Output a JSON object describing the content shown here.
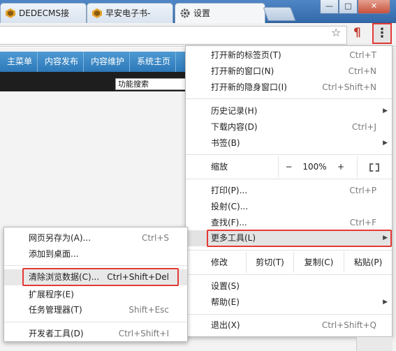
{
  "tabs": [
    {
      "label": "DEDECMS接",
      "icon": "dede-icon"
    },
    {
      "label": "早安电子书-",
      "icon": "dede-icon"
    },
    {
      "label": "设置",
      "icon": "gear-icon"
    }
  ],
  "window_controls": {
    "minimize": "—",
    "maximize": "□",
    "close": "✕"
  },
  "toolbar": {
    "star_icon": "☆",
    "extension_icon": "¶",
    "menu_icon": "⋮"
  },
  "site_nav": [
    "主菜单",
    "内容发布",
    "内容维护",
    "系统主页"
  ],
  "site_search": "功能搜索",
  "main_menu": {
    "group1": [
      {
        "label": "打开新的标签页(T)",
        "shortcut": "Ctrl+T"
      },
      {
        "label": "打开新的窗口(N)",
        "shortcut": "Ctrl+N"
      },
      {
        "label": "打开新的隐身窗口(I)",
        "shortcut": "Ctrl+Shift+N"
      }
    ],
    "group2": [
      {
        "label": "历史记录(H)",
        "shortcut": ""
      },
      {
        "label": "下载内容(D)",
        "shortcut": "Ctrl+J"
      },
      {
        "label": "书签(B)",
        "shortcut": ""
      }
    ],
    "zoom": {
      "label": "缩放",
      "minus": "−",
      "value": "100%",
      "plus": "+"
    },
    "group3": [
      {
        "label": "打印(P)...",
        "shortcut": "Ctrl+P"
      },
      {
        "label": "投射(C)...",
        "shortcut": ""
      },
      {
        "label": "查找(F)...",
        "shortcut": "Ctrl+F"
      },
      {
        "label": "更多工具(L)",
        "shortcut": ""
      }
    ],
    "edit": {
      "label": "修改",
      "cut": "剪切(T)",
      "copy": "复制(C)",
      "paste": "粘贴(P)"
    },
    "group4": [
      {
        "label": "设置(S)",
        "shortcut": ""
      },
      {
        "label": "帮助(E)",
        "shortcut": ""
      }
    ],
    "exit": {
      "label": "退出(X)",
      "shortcut": "Ctrl+Shift+Q"
    }
  },
  "submenu": {
    "group1": [
      {
        "label": "网页另存为(A)...",
        "shortcut": "Ctrl+S"
      },
      {
        "label": "添加到桌面...",
        "shortcut": ""
      }
    ],
    "group2": [
      {
        "label": "清除浏览数据(C)...",
        "shortcut": "Ctrl+Shift+Del"
      },
      {
        "label": "扩展程序(E)",
        "shortcut": ""
      },
      {
        "label": "任务管理器(T)",
        "shortcut": "Shift+Esc"
      }
    ],
    "group3": [
      {
        "label": "开发者工具(D)",
        "shortcut": "Ctrl+Shift+I"
      }
    ]
  },
  "colors": {
    "highlight_border": "#e53935",
    "nav_blue": "#2d78b8",
    "titlebar": "#3b73b5"
  }
}
